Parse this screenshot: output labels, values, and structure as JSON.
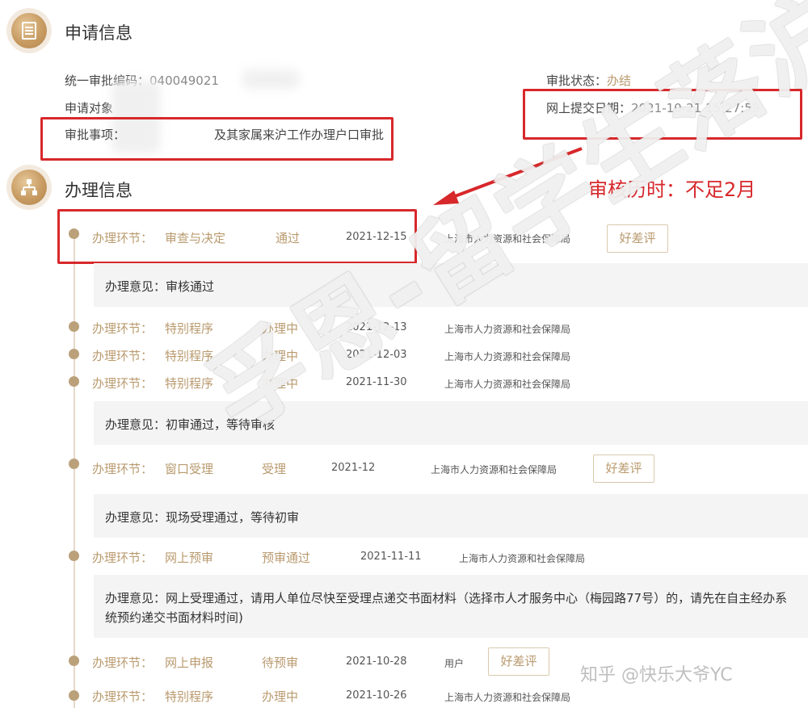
{
  "sections": {
    "apply_title": "申请信息",
    "handle_title": "办理信息"
  },
  "apply": {
    "code_label": "统一审批编码：",
    "code_value": "040049021",
    "object_label": "申请对象",
    "item_label": "审批事项：",
    "item_value": "及其家属来沪工作办理户口审批",
    "status_label": "审批状态：",
    "status_value": "办结",
    "submit_label": "网上提交日期：",
    "submit_value": "2021-10-21 15:27:59"
  },
  "annotation": "审核历时：不足2月",
  "rows": [
    {
      "label": "办理环节：",
      "step": "审查与决定",
      "status": "通过",
      "date": "2021-12-15",
      "dept": "上海市人力资源和社会保障局",
      "eval": "好差评"
    },
    {
      "label": "办理环节：",
      "step": "特别程序",
      "status": "办理中",
      "date": "2021-12-13",
      "dept": "上海市人力资源和社会保障局"
    },
    {
      "label": "办理环节：",
      "step": "特别程序",
      "status": "办理中",
      "date": "2021-12-03",
      "dept": "上海市人力资源和社会保障局"
    },
    {
      "label": "办理环节：",
      "step": "特别程序",
      "status": "办理中",
      "date": "2021-11-30",
      "dept": "上海市人力资源和社会保障局"
    },
    {
      "label": "办理环节：",
      "step": "窗口受理",
      "status": "受理",
      "date": "2021-12",
      "dept": "上海市人力资源和社会保障局",
      "eval": "好差评"
    },
    {
      "label": "办理环节：",
      "step": "网上预审",
      "status": "预审通过",
      "date": "2021-11-11",
      "dept": "上海市人力资源和社会保障局"
    },
    {
      "label": "办理环节：",
      "step": "网上申报",
      "status": "待预审",
      "date": "2021-10-28",
      "dept": "用户",
      "eval": "好差评"
    },
    {
      "label": "办理环节：",
      "step": "特别程序",
      "status": "办理中",
      "date": "2021-10-26",
      "dept": "上海市人力资源和社会保障局"
    }
  ],
  "opinions": [
    "办理意见：审核通过",
    "办理意见：初审通过，等待审核",
    "办理意见：现场受理通过，等待初审",
    "办理意见：网上受理通过，请用人单位尽快至受理点递交书面材料（选择市人才服务中心（梅园路77号）的，请先在自主经办系",
    "统预约递交书面材料时间)"
  ],
  "watermark": "孚恩-留学生落沪",
  "credit": "知乎 @快乐大爷YC"
}
